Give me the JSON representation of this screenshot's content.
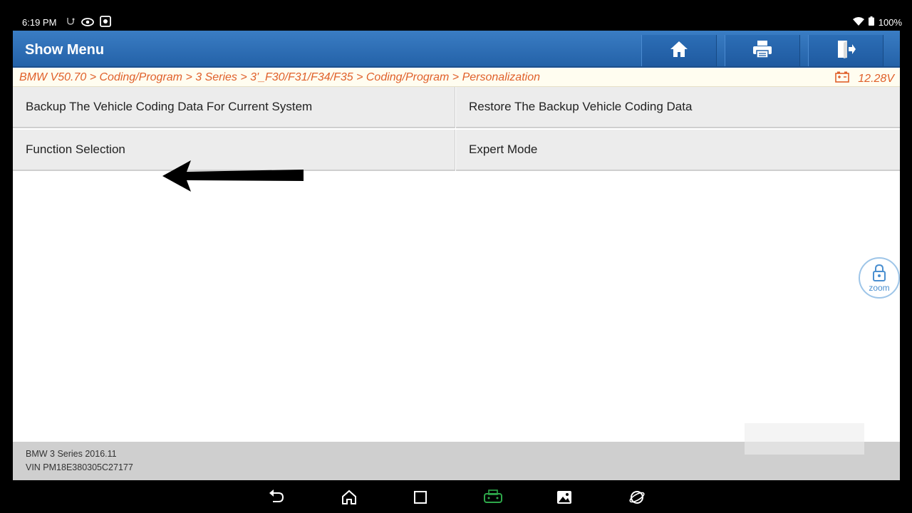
{
  "status_bar": {
    "time": "6:19 PM",
    "battery": "100%",
    "icons": [
      "usb-debug-icon",
      "eye-icon",
      "screen-record-icon",
      "wifi-icon",
      "battery-icon"
    ]
  },
  "header": {
    "title": "Show Menu",
    "buttons": [
      "home-icon",
      "print-icon",
      "exit-icon"
    ]
  },
  "breadcrumb": {
    "path": "BMW V50.70 > Coding/Program > 3 Series > 3'_F30/F31/F34/F35 > Coding/Program > Personalization",
    "voltage": "12.28V"
  },
  "menu": {
    "items": [
      "Backup The Vehicle Coding Data For Current System",
      "Restore The Backup Vehicle Coding Data",
      "Function Selection",
      "Expert Mode"
    ]
  },
  "zoom": {
    "label": "zoom"
  },
  "footer": {
    "vehicle": "BMW 3 Series 2016.11",
    "vin": "VIN PM18E380305C27177"
  },
  "nav_bar": {
    "icons": [
      "back-icon",
      "home-icon",
      "recents-icon",
      "vci-icon",
      "gallery-icon",
      "browser-icon"
    ],
    "accent": "#2ea84a"
  }
}
